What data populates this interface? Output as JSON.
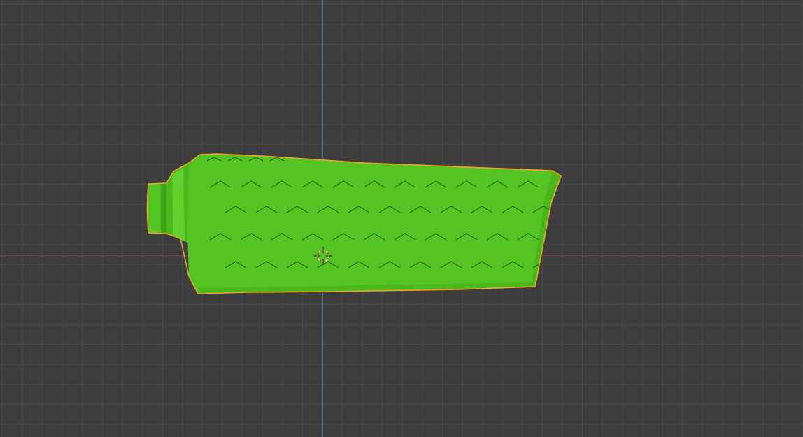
{
  "viewport": {
    "background_color": "#3d3d3d",
    "grid_color": "#4b4b4b",
    "x_axis_color": "#8a3b45",
    "y_axis_color": "#3f6ea6"
  },
  "object": {
    "fill_color": "#54c423",
    "shade_color": "#3da316",
    "highlight_color": "#66d432",
    "outline_color": "#f5a623",
    "pattern_color": "#24530f",
    "selected": true
  },
  "cursor": {
    "icon": "3d-cursor-icon",
    "ring_color_a": "#e04444",
    "ring_color_b": "#f2f2f2"
  }
}
